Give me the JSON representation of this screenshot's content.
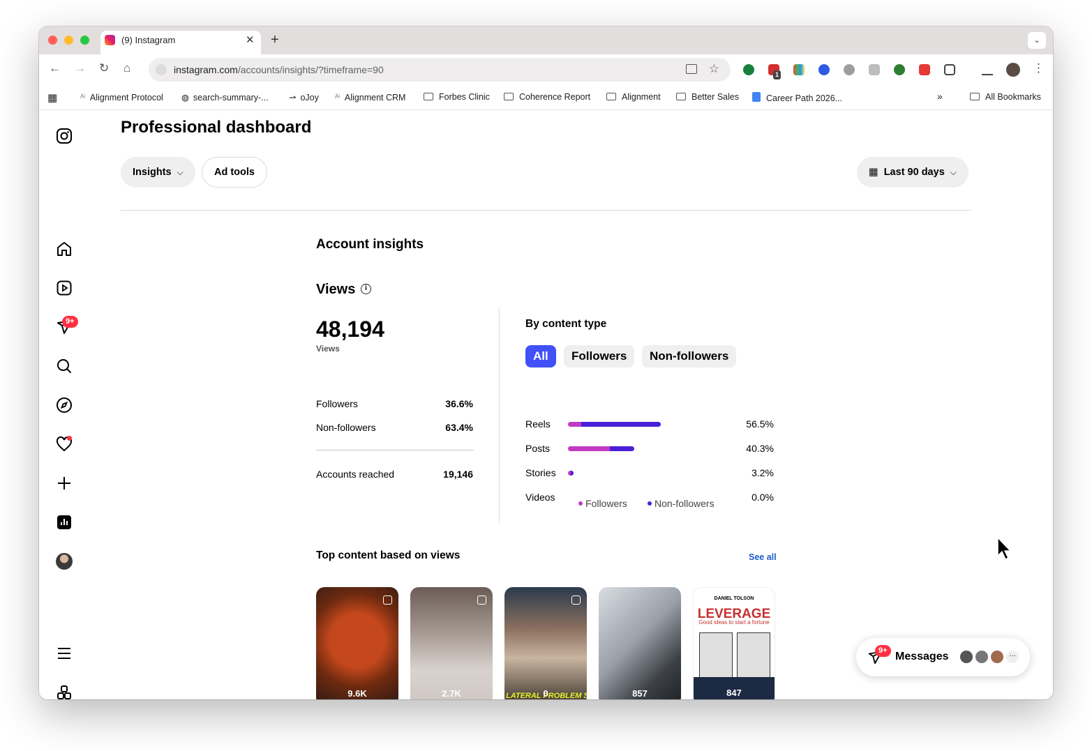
{
  "browser": {
    "tab_title": "(9) Instagram",
    "url_host": "instagram.com",
    "url_path": "/accounts/insights/?timeframe=90",
    "bookmarks": [
      "Alignment Protocol",
      "search-summary-...",
      "oJoy",
      "Alignment CRM",
      "Forbes Clinic",
      "Coherence Report",
      "Alignment",
      "Better Sales",
      "Career Path 2026...",
      "All Bookmarks"
    ],
    "ext_badge": "1",
    "chevron": "»"
  },
  "header": {
    "title": "Professional dashboard",
    "insights_label": "Insights",
    "adtools_label": "Ad tools",
    "range_label": "Last 90 days"
  },
  "nav": {
    "notif_badge": "9+"
  },
  "insights": {
    "section_title": "Account insights",
    "views_title": "Views",
    "views_total": "48,194",
    "views_label": "Views",
    "followers_label": "Followers",
    "followers_pct": "36.6%",
    "nonfollowers_label": "Non-followers",
    "nonfollowers_pct": "63.4%",
    "reached_label": "Accounts reached",
    "reached_value": "19,146"
  },
  "content_type": {
    "title": "By content type",
    "tabs": [
      "All",
      "Followers",
      "Non-followers"
    ],
    "rows": [
      {
        "label": "Reels",
        "value": "56.5%",
        "pct": 56.5,
        "followers_share": 0.14
      },
      {
        "label": "Posts",
        "value": "40.3%",
        "pct": 40.3,
        "followers_share": 0.63
      },
      {
        "label": "Stories",
        "value": "3.2%",
        "pct": 3.2,
        "followers_share": 0.55
      },
      {
        "label": "Videos",
        "value": "0.0%",
        "pct": 0.0,
        "followers_share": 0
      }
    ],
    "legend_followers": "Followers",
    "legend_nonfollowers": "Non-followers",
    "colors": {
      "followers": "#c13ac4",
      "nonfollowers": "#4a1fd8",
      "active_tab": "#4150f7"
    }
  },
  "top_content": {
    "title": "Top content based on views",
    "see_all": "See all",
    "items": [
      {
        "count": "9.6K"
      },
      {
        "count": "2.7K"
      },
      {
        "count": "0"
      },
      {
        "count": "857"
      },
      {
        "count": "847"
      }
    ],
    "leverage_author": "DANIEL TOLSON",
    "leverage_title": "LEVERAGE",
    "leverage_sub": "Good ideas to start a fortune",
    "caption3": "LATERAL PROBLEM SO"
  },
  "messages": {
    "label": "Messages",
    "badge": "9+",
    "more": "···"
  }
}
